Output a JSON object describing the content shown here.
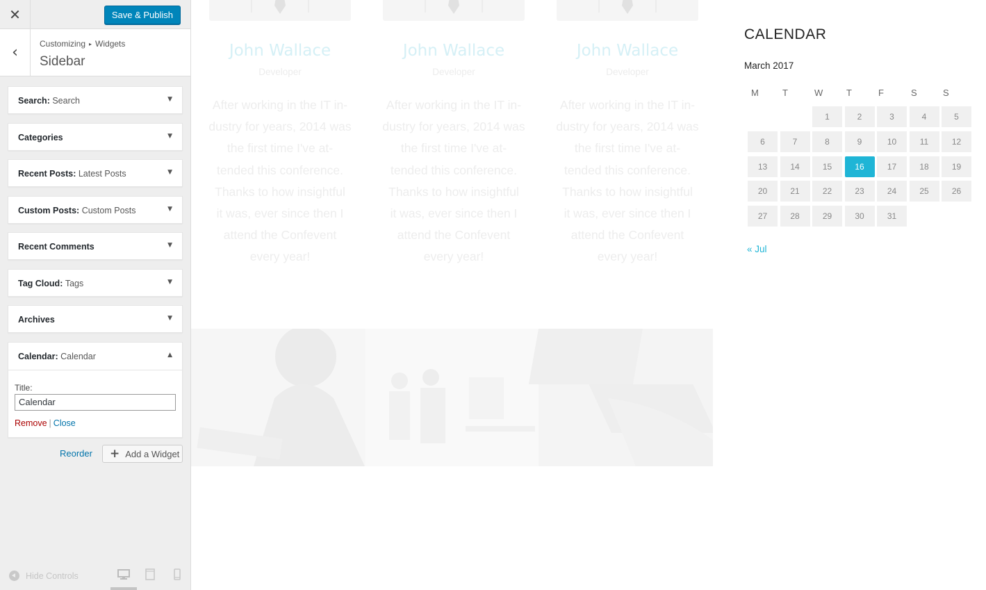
{
  "customizer": {
    "close_glyph": "✕",
    "publish_label": "Save & Publish",
    "back_glyph": "‹",
    "breadcrumb": {
      "parent": "Customizing",
      "separator": "▸",
      "current": "Widgets"
    },
    "section_title": "Sidebar",
    "widgets": [
      {
        "name": "Search",
        "title": "Search",
        "expanded": false
      },
      {
        "name": "Categories",
        "title": "",
        "expanded": false
      },
      {
        "name": "Recent Posts",
        "title": "Latest Posts",
        "expanded": false
      },
      {
        "name": "Custom Posts",
        "title": "Custom Posts",
        "expanded": false
      },
      {
        "name": "Recent Comments",
        "title": "",
        "expanded": false
      },
      {
        "name": "Tag Cloud",
        "title": "Tags",
        "expanded": false
      },
      {
        "name": "Archives",
        "title": "",
        "expanded": false
      },
      {
        "name": "Calendar",
        "title": "Calendar",
        "expanded": true
      }
    ],
    "calendar_widget_form": {
      "title_label": "Title:",
      "title_value": "Calendar",
      "remove_label": "Remove",
      "separator": "|",
      "close_label": "Close"
    },
    "collapse_arrow": "▼",
    "expand_arrow": "▲",
    "reorder_label": "Reorder",
    "add_widget_label": "Add a Widget",
    "hide_controls_label": "Hide Controls",
    "devices": [
      "desktop-icon",
      "tablet-icon",
      "mobile-icon"
    ],
    "active_device": "desktop-icon",
    "colors": {
      "primary": "#0085ba",
      "link": "#0073aa",
      "remove": "#a00000"
    }
  },
  "preview": {
    "team": [
      {
        "name": "John Wallace",
        "role": "Developer",
        "quote_lines": [
          "After working in the IT in-",
          "dustry for years, 2014 was",
          "the first time I've at-",
          "tended this conference.",
          "Thanks to how insightful",
          "it was, ever since then I",
          "attend the Confevent",
          "every year!"
        ]
      },
      {
        "name": "John Wallace",
        "role": "Developer",
        "quote_lines": [
          "After working in the IT in-",
          "dustry for years, 2014 was",
          "the first time I've at-",
          "tended this conference.",
          "Thanks to how insightful",
          "it was, ever since then I",
          "attend the Confevent",
          "every year!"
        ]
      },
      {
        "name": "John Wallace",
        "role": "Developer",
        "quote_lines": [
          "After working in the IT in-",
          "dustry for years, 2014 was",
          "the first time I've at-",
          "tended this conference.",
          "Thanks to how insightful",
          "it was, ever since then I",
          "attend the Confevent",
          "every year!"
        ]
      }
    ],
    "calendar": {
      "heading": "CALENDAR",
      "month": "March 2017",
      "weekdays": [
        "M",
        "T",
        "W",
        "T",
        "F",
        "S",
        "S"
      ],
      "first_weekday_index": 2,
      "days_in_month": 31,
      "today": 16,
      "prev_link": "« Jul",
      "accent": "#1fb5d6"
    }
  }
}
